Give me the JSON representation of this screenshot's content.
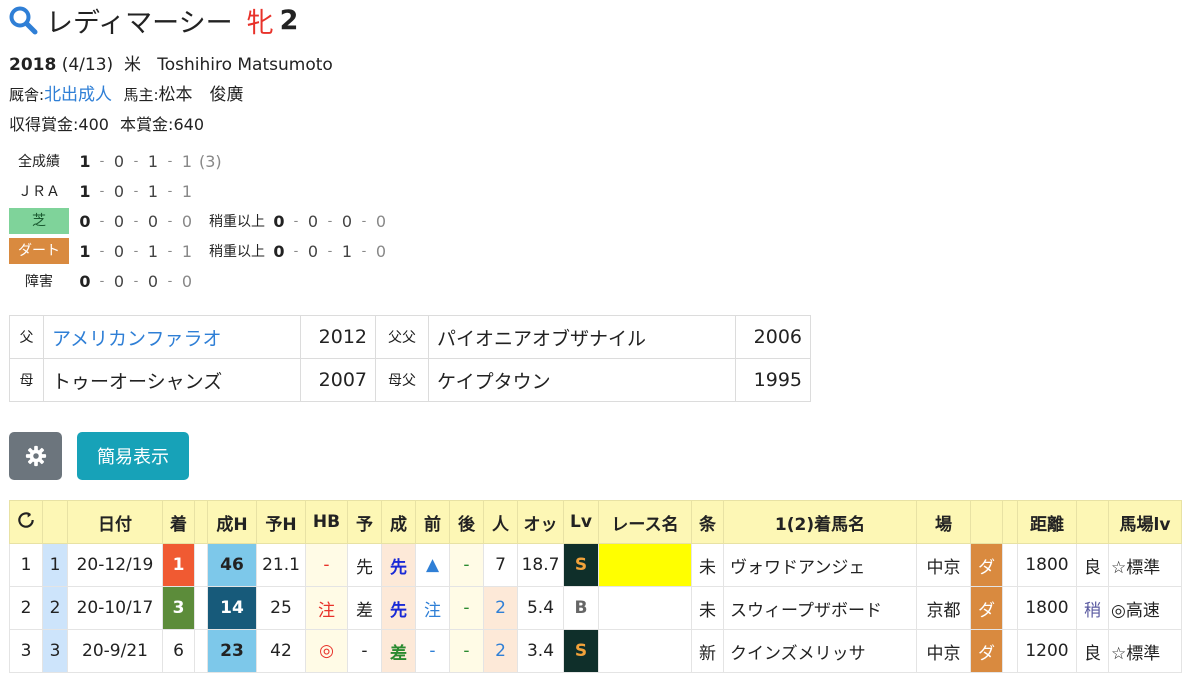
{
  "horse": {
    "name": "レディマーシー",
    "sex": "牝",
    "age": "2"
  },
  "profile": {
    "birth_year": "2018",
    "birth_date": "(4/13)",
    "origin": "米",
    "breeder": "Toshihiro Matsumoto",
    "stable_label": "厩舎:",
    "stable": "北出成人",
    "owner_label": "馬主:",
    "owner": "松本　俊廣",
    "earned_label": "収得賞金:",
    "earned": "400",
    "prize_label": "本賞金:",
    "prize": "640"
  },
  "stats": [
    {
      "label": "全成績",
      "nums": [
        "1",
        "0",
        "1",
        "1"
      ],
      "extra": "(3)"
    },
    {
      "label": "ＪＲＡ",
      "nums": [
        "1",
        "0",
        "1",
        "1"
      ]
    },
    {
      "label": "芝",
      "nums": [
        "0",
        "0",
        "0",
        "0"
      ],
      "sub_label": "稍重以上",
      "sub_nums": [
        "0",
        "0",
        "0",
        "0"
      ]
    },
    {
      "label": "ダート",
      "nums": [
        "1",
        "0",
        "1",
        "1"
      ],
      "sub_label": "稍重以上",
      "sub_nums": [
        "0",
        "0",
        "1",
        "0"
      ]
    },
    {
      "label": "障害",
      "nums": [
        "0",
        "0",
        "0",
        "0"
      ]
    }
  ],
  "pedigree": {
    "sire_label": "父",
    "sire": "アメリカンファラオ",
    "sire_year": "2012",
    "sire_sire_label": "父父",
    "sire_sire": "パイオニアオブザナイル",
    "sire_sire_year": "2006",
    "dam_label": "母",
    "dam": "トゥーオーシャンズ",
    "dam_year": "2007",
    "dam_sire_label": "母父",
    "dam_sire": "ケイプタウン",
    "dam_sire_year": "1995"
  },
  "buttons": {
    "simple_view": "簡易表示"
  },
  "results_table": {
    "headers": [
      "日付",
      "着",
      "成H",
      "予H",
      "HB",
      "予",
      "成",
      "前",
      "後",
      "人",
      "オッ",
      "Lv",
      "レース名",
      "条",
      "1(2)着馬名",
      "場",
      "距離",
      "馬場lv"
    ],
    "rows": [
      {
        "no": "1",
        "sel": "1",
        "date": "20-12/19",
        "rank": "1",
        "seiH": "46",
        "yoH": "21.1",
        "hb": "-",
        "yo": "先",
        "sei": "先",
        "mae": "▲",
        "ato": "-",
        "pop": "7",
        "odds": "18.7",
        "lv": "S",
        "race": "",
        "jo": "未",
        "winner": "ヴォワドアンジェ",
        "track": "中京",
        "surface": "ダ",
        "dist": "1800",
        "cond": "良",
        "condlv": "☆標準"
      },
      {
        "no": "2",
        "sel": "2",
        "date": "20-10/17",
        "rank": "3",
        "seiH": "14",
        "yoH": "25",
        "hb": "注",
        "yo": "差",
        "sei": "先",
        "mae": "注",
        "ato": "-",
        "pop": "2",
        "odds": "5.4",
        "lv": "B",
        "race": "",
        "jo": "未",
        "winner": "スウィープザボード",
        "track": "京都",
        "surface": "ダ",
        "dist": "1800",
        "cond": "稍",
        "condlv": "◎高速"
      },
      {
        "no": "3",
        "sel": "3",
        "date": "20-9/21",
        "rank": "6",
        "seiH": "23",
        "yoH": "42",
        "hb": "◎",
        "yo": "-",
        "sei": "差",
        "mae": "-",
        "ato": "-",
        "pop": "2",
        "odds": "3.4",
        "lv": "S",
        "race": "",
        "jo": "新",
        "winner": "クインズメリッサ",
        "track": "中京",
        "surface": "ダ",
        "dist": "1200",
        "cond": "良",
        "condlv": "☆標準"
      }
    ]
  },
  "icons": {
    "search": "search-icon",
    "gear": "gear-icon",
    "refresh": "refresh-icon"
  },
  "colors": {
    "turf": "#7fd39a",
    "dirt": "#d98a3f",
    "header_bg": "#fdf7b5",
    "rank1": "#f05a32",
    "rank3": "#5c8c3a",
    "lvS": "#0f2f2a",
    "accent": "#17a2b8"
  }
}
